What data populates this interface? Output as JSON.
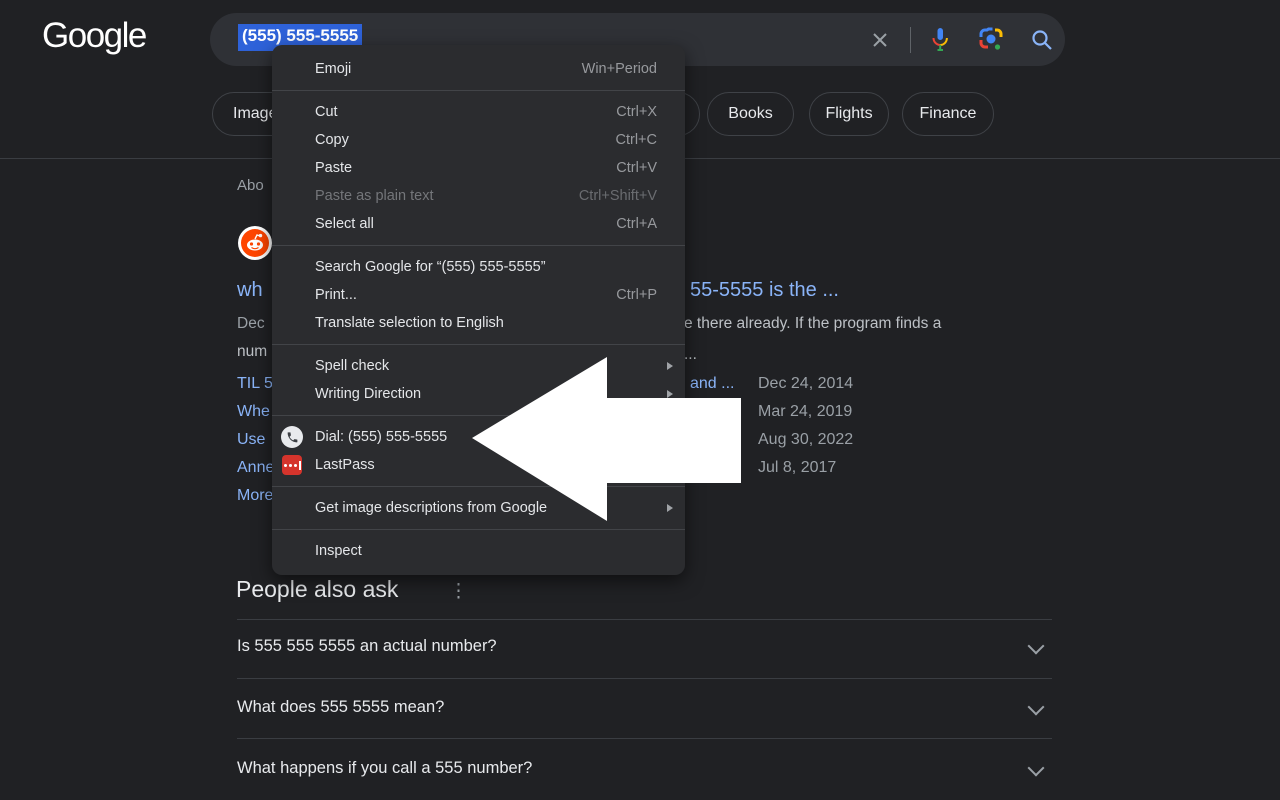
{
  "header": {
    "logo": "Google",
    "search": {
      "query": "(555) 555-5555"
    }
  },
  "tabs": [
    "Images",
    "Books",
    "Flights",
    "Finance"
  ],
  "results": {
    "stats_fragment": "Abo",
    "title_left": "wh",
    "title_right": "55-5555 is the ...",
    "snippet1_left": "Dec",
    "snippet1_right": "e there already. If the program finds a",
    "snippet2_left": "num",
    "snippet2_right": "...",
    "sublinks": [
      {
        "left": "TIL 5",
        "right": "and ...",
        "date": "Dec 24, 2014"
      },
      {
        "left": "Whe",
        "date": "Mar 24, 2019"
      },
      {
        "left": "Use",
        "date": "Aug 30, 2022"
      },
      {
        "left": "Anne",
        "date": "Jul 8, 2017"
      },
      {
        "left": "More"
      }
    ]
  },
  "context_menu": {
    "items": [
      {
        "label": "Emoji",
        "shortcut": "Win+Period"
      },
      {
        "label": "Cut",
        "shortcut": "Ctrl+X"
      },
      {
        "label": "Copy",
        "shortcut": "Ctrl+C"
      },
      {
        "label": "Paste",
        "shortcut": "Ctrl+V"
      },
      {
        "label": "Paste as plain text",
        "shortcut": "Ctrl+Shift+V"
      },
      {
        "label": "Select all",
        "shortcut": "Ctrl+A"
      },
      {
        "label": "Search Google for “(555) 555-5555”"
      },
      {
        "label": "Print...",
        "shortcut": "Ctrl+P"
      },
      {
        "label": "Translate selection to English"
      },
      {
        "label": "Spell check"
      },
      {
        "label": "Writing Direction"
      },
      {
        "label": "Dial: (555) 555-5555"
      },
      {
        "label": "LastPass"
      },
      {
        "label": "Get image descriptions from Google"
      },
      {
        "label": "Inspect"
      }
    ]
  },
  "people_also_ask": {
    "title": "People also ask",
    "questions": [
      "Is 555 555 5555 an actual number?",
      "What does 555 5555 mean?",
      "What happens if you call a 555 number?"
    ]
  },
  "colors": {
    "link_blue": "#8ab4f8",
    "selection_blue": "#2e62d9",
    "google_blue": "#4285f4",
    "google_red": "#ea4335",
    "google_yellow": "#fbbc04",
    "google_green": "#34a853",
    "lastpass_red": "#d5342c"
  }
}
